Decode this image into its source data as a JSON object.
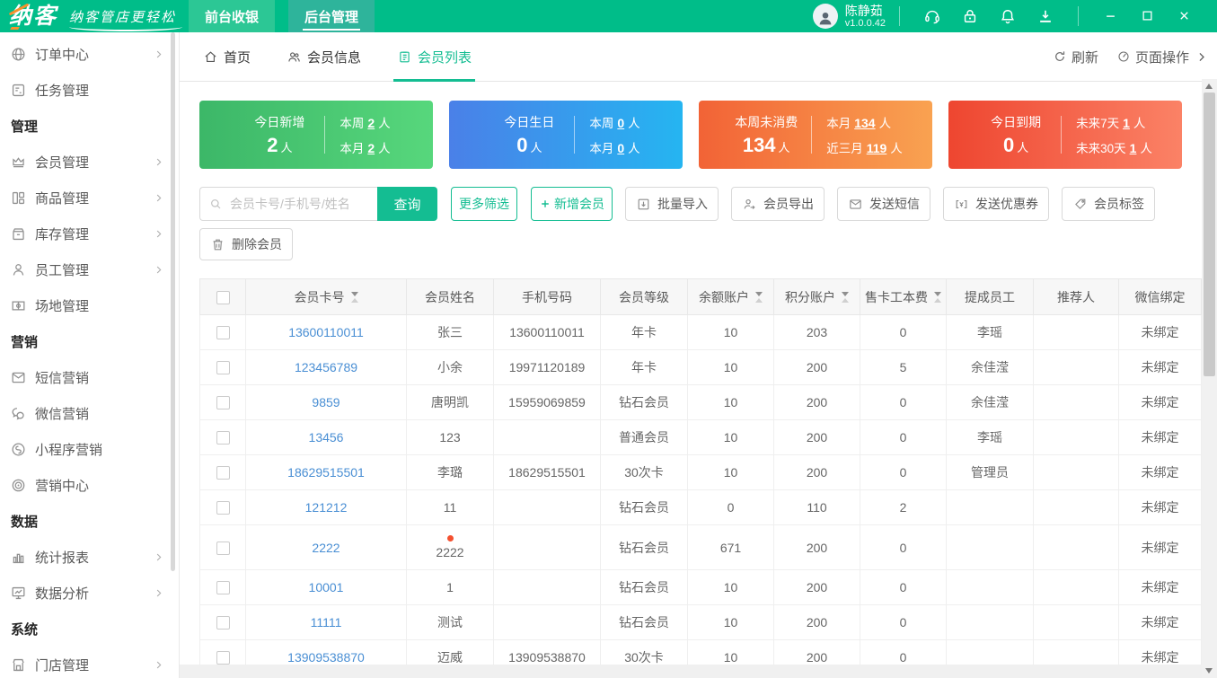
{
  "window": {
    "logo_text": "纳客",
    "slogan": "纳客管店更轻松",
    "nav_tabs": [
      {
        "label": "前台收银",
        "active": false
      },
      {
        "label": "后台管理",
        "active": true
      }
    ],
    "user": {
      "name": "陈静茹",
      "version": "v1.0.0.42"
    },
    "header_icons": [
      "headset-icon",
      "lock-icon",
      "bell-icon",
      "download-icon"
    ],
    "window_controls": [
      "minimize",
      "maximize",
      "close"
    ]
  },
  "colors": {
    "header_green": "#00bd89",
    "accent_green": "#14bd92",
    "link_blue": "#4a8fd4",
    "badge_red": "#f4502f",
    "card_green": [
      "#3cb768",
      "#57d77c"
    ],
    "card_blue": [
      "#4a80e8",
      "#25b5f1"
    ],
    "card_orange": [
      "#f26336",
      "#f9a251"
    ],
    "card_red": [
      "#ee4630",
      "#fb8266"
    ]
  },
  "sidebar": {
    "items": [
      {
        "type": "item",
        "icon": "globe-icon",
        "label": "订单中心",
        "chevron": true
      },
      {
        "type": "item",
        "icon": "tasks-icon",
        "label": "任务管理",
        "chevron": false
      },
      {
        "type": "section",
        "label": "管理"
      },
      {
        "type": "item",
        "icon": "crown-icon",
        "label": "会员管理",
        "chevron": true
      },
      {
        "type": "item",
        "icon": "goods-icon",
        "label": "商品管理",
        "chevron": true
      },
      {
        "type": "item",
        "icon": "inventory-icon",
        "label": "库存管理",
        "chevron": true
      },
      {
        "type": "item",
        "icon": "staff-icon",
        "label": "员工管理",
        "chevron": true
      },
      {
        "type": "item",
        "icon": "venue-icon",
        "label": "场地管理",
        "chevron": false
      },
      {
        "type": "section",
        "label": "营销"
      },
      {
        "type": "item",
        "icon": "sms-icon",
        "label": "短信营销",
        "chevron": false
      },
      {
        "type": "item",
        "icon": "wechat-icon",
        "label": "微信营销",
        "chevron": false
      },
      {
        "type": "item",
        "icon": "miniprogram-icon",
        "label": "小程序营销",
        "chevron": false
      },
      {
        "type": "item",
        "icon": "target-icon",
        "label": "营销中心",
        "chevron": false
      },
      {
        "type": "section",
        "label": "数据"
      },
      {
        "type": "item",
        "icon": "chart-icon",
        "label": "统计报表",
        "chevron": true
      },
      {
        "type": "item",
        "icon": "monitor-icon",
        "label": "数据分析",
        "chevron": true
      },
      {
        "type": "section",
        "label": "系统"
      },
      {
        "type": "item",
        "icon": "store-icon",
        "label": "门店管理",
        "chevron": true
      }
    ]
  },
  "tabbar": {
    "tabs": [
      {
        "label": "首页",
        "icon": "home-icon",
        "active": false
      },
      {
        "label": "会员信息",
        "icon": "users-icon",
        "active": false
      },
      {
        "label": "会员列表",
        "icon": "list-icon",
        "active": true
      }
    ],
    "refresh_label": "刷新",
    "page_actions_label": "页面操作"
  },
  "stats": {
    "cards": [
      {
        "title": "今日新增",
        "value": "2",
        "unit": "人",
        "rows": [
          {
            "label": "本周",
            "value": "2",
            "unit": "人"
          },
          {
            "label": "本月",
            "value": "2",
            "unit": "人"
          }
        ]
      },
      {
        "title": "今日生日",
        "value": "0",
        "unit": "人",
        "rows": [
          {
            "label": "本周",
            "value": "0",
            "unit": "人"
          },
          {
            "label": "本月",
            "value": "0",
            "unit": "人"
          }
        ]
      },
      {
        "title": "本周未消费",
        "value": "134",
        "unit": "人",
        "rows": [
          {
            "label": "本月",
            "value": "134",
            "unit": "人"
          },
          {
            "label": "近三月",
            "value": "119",
            "unit": "人"
          }
        ]
      },
      {
        "title": "今日到期",
        "value": "0",
        "unit": "人",
        "rows": [
          {
            "label": "未来7天",
            "value": "1",
            "unit": "人"
          },
          {
            "label": "未来30天",
            "value": "1",
            "unit": "人"
          }
        ]
      }
    ]
  },
  "toolbar": {
    "search_placeholder": "会员卡号/手机号/姓名",
    "search_label": "查询",
    "filter_label": "更多筛选",
    "add_member_label": "新增会员",
    "import_label": "批量导入",
    "export_label": "会员导出",
    "send_sms_label": "发送短信",
    "send_coupon_label": "发送优惠券",
    "tag_label": "会员标签",
    "delete_label": "删除会员"
  },
  "table": {
    "columns": [
      {
        "label": "会员卡号",
        "sortable": true
      },
      {
        "label": "会员姓名",
        "sortable": false
      },
      {
        "label": "手机号码",
        "sortable": false
      },
      {
        "label": "会员等级",
        "sortable": false
      },
      {
        "label": "余额账户",
        "sortable": true
      },
      {
        "label": "积分账户",
        "sortable": true
      },
      {
        "label": "售卡工本费",
        "sortable": true
      },
      {
        "label": "提成员工",
        "sortable": false
      },
      {
        "label": "推荐人",
        "sortable": false
      },
      {
        "label": "微信绑定",
        "sortable": false
      }
    ],
    "rows": [
      {
        "cells": [
          "13600110011",
          "张三",
          "13600110011",
          "年卡",
          "10",
          "203",
          "0",
          "李瑶",
          "",
          "未绑定"
        ]
      },
      {
        "cells": [
          "123456789",
          "小余",
          "19971120189",
          "年卡",
          "10",
          "200",
          "5",
          "余佳滢",
          "",
          "未绑定"
        ]
      },
      {
        "cells": [
          "9859",
          "唐明凯",
          "15959069859",
          "钻石会员",
          "10",
          "200",
          "0",
          "余佳滢",
          "",
          "未绑定"
        ]
      },
      {
        "cells": [
          "13456",
          "123",
          "",
          "普通会员",
          "10",
          "200",
          "0",
          "李瑶",
          "",
          "未绑定"
        ]
      },
      {
        "cells": [
          "18629515501",
          "李璐",
          "18629515501",
          "30次卡",
          "10",
          "200",
          "0",
          "管理员",
          "",
          "未绑定"
        ]
      },
      {
        "cells": [
          "121212",
          "11",
          "",
          "钻石会员",
          "0",
          "110",
          "2",
          "",
          "",
          "未绑定"
        ]
      },
      {
        "cells": [
          "2222",
          "2222",
          "",
          "钻石会员",
          "671",
          "200",
          "0",
          "",
          "",
          "未绑定"
        ],
        "badge": true
      },
      {
        "cells": [
          "10001",
          "1",
          "",
          "钻石会员",
          "10",
          "200",
          "0",
          "",
          "",
          "未绑定"
        ]
      },
      {
        "cells": [
          "11111",
          "测试",
          "",
          "钻石会员",
          "10",
          "200",
          "0",
          "",
          "",
          "未绑定"
        ]
      },
      {
        "cells": [
          "13909538870",
          "迈威",
          "13909538870",
          "30次卡",
          "10",
          "200",
          "0",
          "",
          "",
          "未绑定"
        ]
      }
    ]
  }
}
